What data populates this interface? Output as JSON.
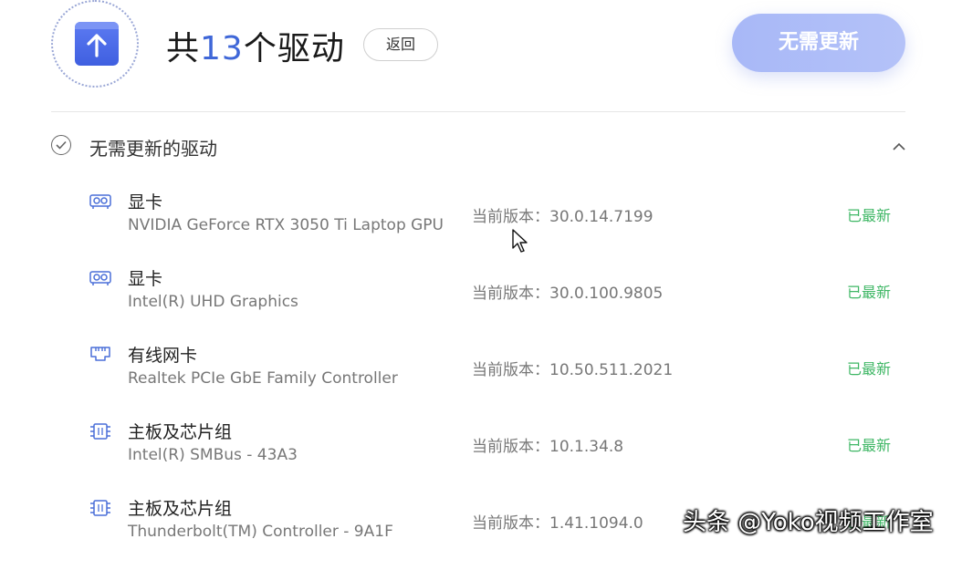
{
  "header": {
    "title_prefix": "共",
    "count": "13",
    "title_suffix": "个驱动",
    "back_label": "返回",
    "action_label": "无需更新"
  },
  "section": {
    "label": "无需更新的驱动",
    "status_icon": "check-circle-icon",
    "collapse_icon": "chevron-up-icon"
  },
  "colors": {
    "accent": "#3f67d8",
    "button": "#a8b8f7",
    "status_green": "#3fb765"
  },
  "drivers": [
    {
      "icon": "gpu-icon",
      "category": "显卡",
      "model": "NVIDIA GeForce RTX 3050 Ti Laptop GPU",
      "version_label": "当前版本：",
      "version": "30.0.14.7199",
      "status": "已最新"
    },
    {
      "icon": "gpu-icon",
      "category": "显卡",
      "model": "Intel(R) UHD Graphics",
      "version_label": "当前版本：",
      "version": "30.0.100.9805",
      "status": "已最新"
    },
    {
      "icon": "ethernet-icon",
      "category": "有线网卡",
      "model": "Realtek PCIe GbE Family Controller",
      "version_label": "当前版本：",
      "version": "10.50.511.2021",
      "status": "已最新"
    },
    {
      "icon": "chip-icon",
      "category": "主板及芯片组",
      "model": "Intel(R) SMBus - 43A3",
      "version_label": "当前版本：",
      "version": "10.1.34.8",
      "status": "已最新"
    },
    {
      "icon": "chip-icon",
      "category": "主板及芯片组",
      "model": "Thunderbolt(TM) Controller - 9A1F",
      "version_label": "当前版本：",
      "version": "1.41.1094.0",
      "status": "已最新"
    }
  ],
  "watermark": "头条 @Yoko视频工作室"
}
